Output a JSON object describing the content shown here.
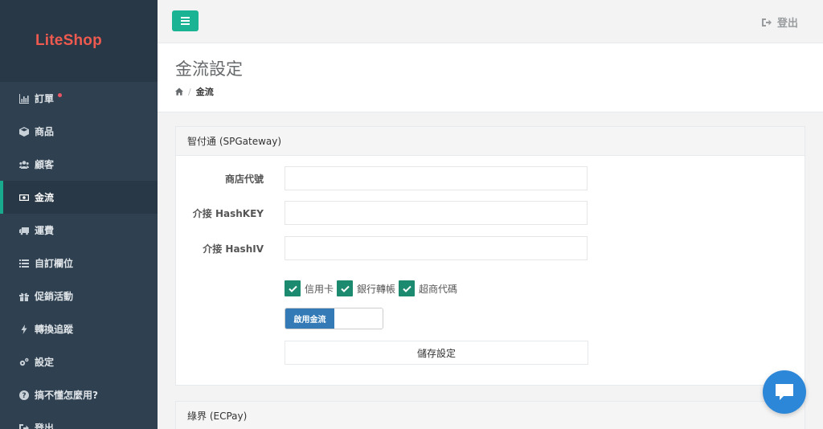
{
  "brand": {
    "name": "LiteShop",
    "color": "#ee5a4f"
  },
  "sidebar": {
    "items": [
      {
        "label": "訂單",
        "icon": "bar-chart-icon",
        "badge": true
      },
      {
        "label": "商品",
        "icon": "cube-icon"
      },
      {
        "label": "顧客",
        "icon": "users-icon"
      },
      {
        "label": "金流",
        "icon": "money-icon",
        "active": true
      },
      {
        "label": "運費",
        "icon": "truck-icon"
      },
      {
        "label": "自訂欄位",
        "icon": "list-icon"
      },
      {
        "label": "促銷活動",
        "icon": "gift-icon"
      },
      {
        "label": "轉換追蹤",
        "icon": "bolt-icon"
      },
      {
        "label": "設定",
        "icon": "cogs-icon"
      },
      {
        "label": "搞不懂怎麼用?",
        "icon": "question-icon"
      },
      {
        "label": "登出",
        "icon": "sign-out-icon"
      }
    ]
  },
  "topbar": {
    "logout_label": "登出"
  },
  "page": {
    "title": "金流設定",
    "breadcrumb_current": "金流"
  },
  "spgateway": {
    "heading": "智付通 (SPGateway)",
    "fields": {
      "store_id_label": "商店代號",
      "store_id_value": "",
      "hashkey_label": "介接 HashKEY",
      "hashkey_value": "",
      "hashiv_label": "介接 HashIV",
      "hashiv_value": ""
    },
    "checkboxes": [
      {
        "label": "信用卡",
        "checked": true
      },
      {
        "label": "銀行轉帳",
        "checked": true
      },
      {
        "label": "超商代碼",
        "checked": true
      }
    ],
    "toggle_label": "啟用金流",
    "save_label": "儲存設定"
  },
  "ecpay": {
    "heading": "綠界 (ECPay)"
  },
  "colors": {
    "accent": "#1ab394",
    "sidebar": "#2f4050",
    "toggle": "#337ab7",
    "chat": "#2d87d9"
  }
}
